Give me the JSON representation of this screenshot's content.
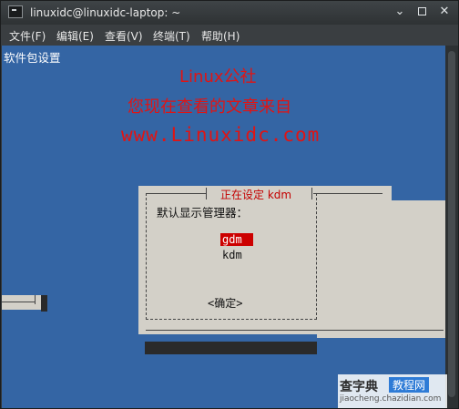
{
  "window": {
    "title": "linuxidc@linuxidc-laptop: ~",
    "controls": {
      "minimize": "⌄",
      "close": "✕"
    }
  },
  "menu": [
    {
      "label": "文件(F)"
    },
    {
      "label": "编辑(E)"
    },
    {
      "label": "查看(V)"
    },
    {
      "label": "终端(T)"
    },
    {
      "label": "帮助(H)"
    }
  ],
  "terminal": {
    "header": "软件包设置",
    "background_color": "#3465a4"
  },
  "watermark": {
    "line1": "Linux公社",
    "line2": "您现在查看的文章来自",
    "line3": "www.Linuxidc.com"
  },
  "dialog": {
    "title": "正在设定 kdm",
    "prompt": "默认显示管理器：",
    "options": [
      {
        "label": "gdm",
        "selected": true
      },
      {
        "label": "kdm",
        "selected": false
      }
    ],
    "ok_label": "<确定>"
  },
  "logo": {
    "main": "查字典",
    "tag": "教程网",
    "url": "jiaocheng.chazidian.com"
  }
}
